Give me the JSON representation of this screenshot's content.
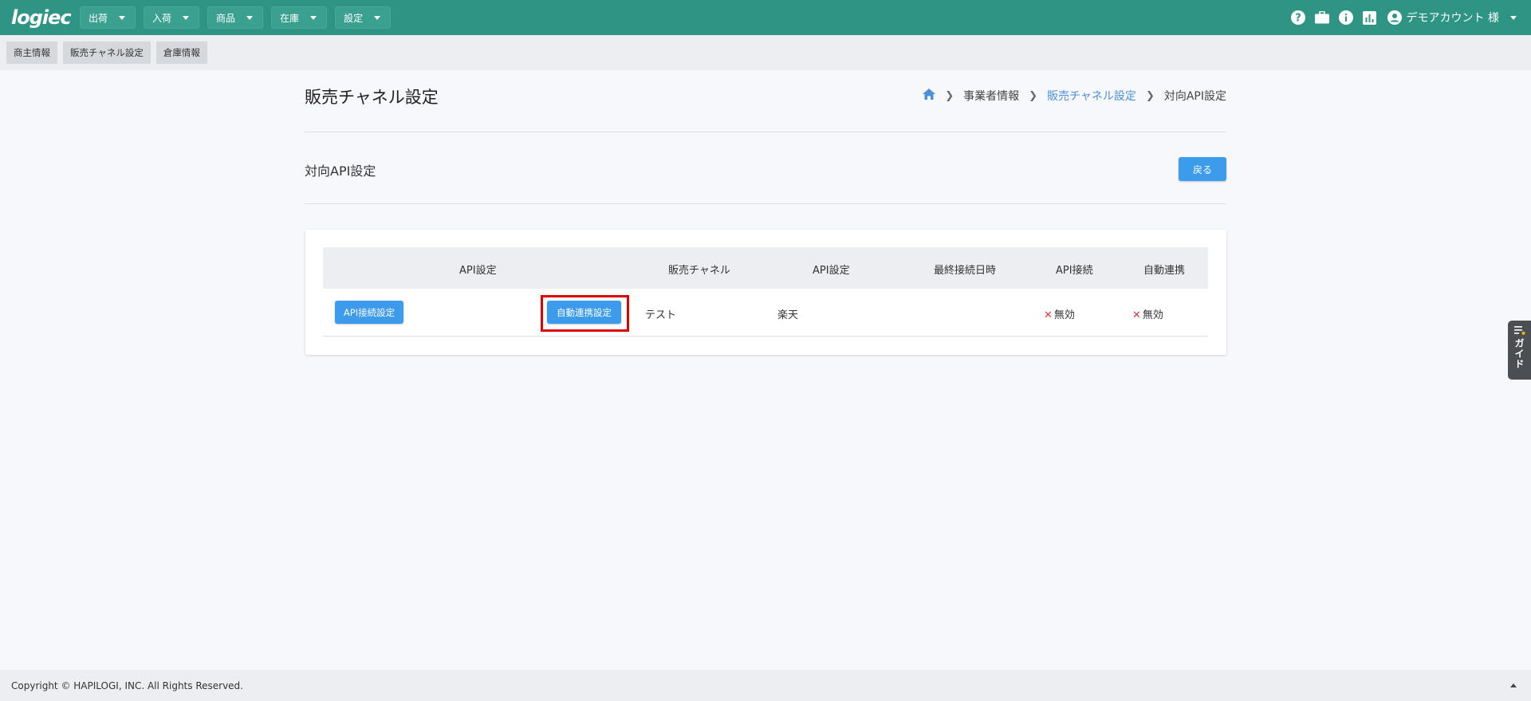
{
  "app": {
    "logo": "logiec"
  },
  "nav": {
    "menus": [
      {
        "label": "出荷"
      },
      {
        "label": "入荷"
      },
      {
        "label": "商品"
      },
      {
        "label": "在庫"
      },
      {
        "label": "設定"
      }
    ],
    "user_label": "デモアカウント 様"
  },
  "subtabs": [
    {
      "label": "商主情報"
    },
    {
      "label": "販売チャネル設定"
    },
    {
      "label": "倉庫情報"
    }
  ],
  "page": {
    "title": "販売チャネル設定",
    "breadcrumb": {
      "item1": "事業者情報",
      "item2": "販売チャネル設定",
      "current": "対向API設定"
    },
    "section_title": "対向API設定",
    "back_label": "戻る"
  },
  "table": {
    "headers": {
      "api_settings": "API設定",
      "channel": "販売チャネル",
      "api_type": "API設定",
      "last_connected": "最終接続日時",
      "api_connection": "API接続",
      "auto_link": "自動連携"
    },
    "rows": [
      {
        "api_connect_button": "API接続設定",
        "auto_link_button": "自動連携設定",
        "channel": "テスト",
        "api_type": "楽天",
        "last_connected": "",
        "api_connection": "無効",
        "auto_link": "無効"
      }
    ]
  },
  "guide": {
    "label": "ガイド"
  },
  "footer": {
    "copyright": "Copyright © HAPILOGI, INC. All Rights Reserved."
  }
}
